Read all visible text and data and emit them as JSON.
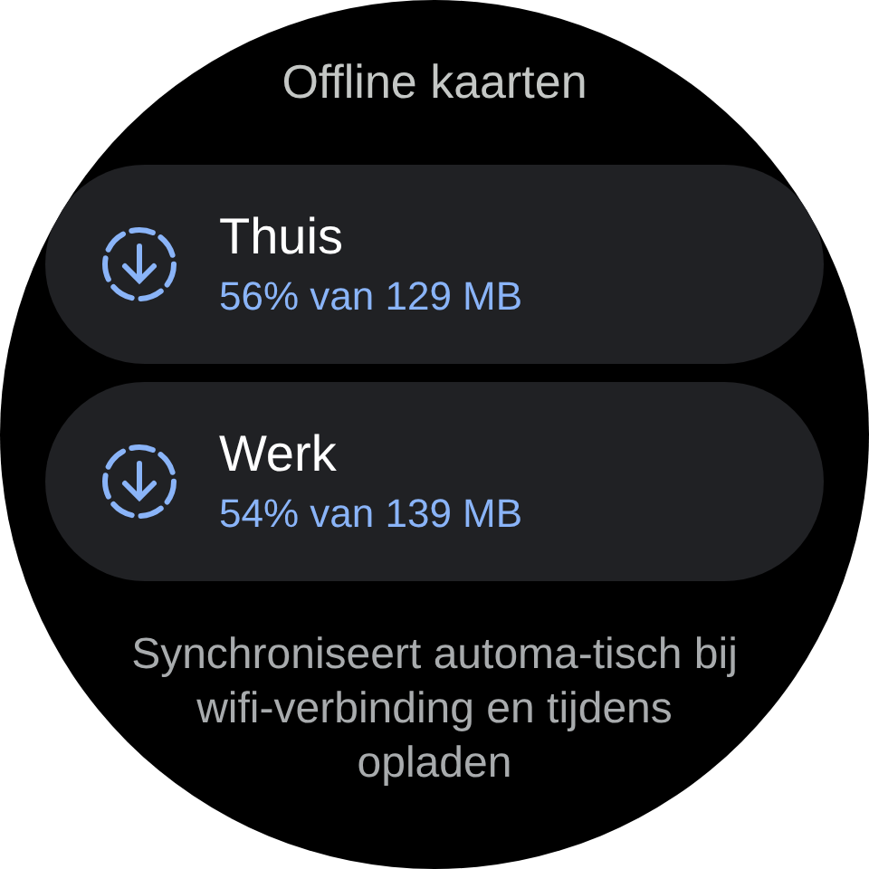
{
  "title": "Offline kaarten",
  "maps": [
    {
      "name": "Thuis",
      "progress": "56% van 129 MB"
    },
    {
      "name": "Werk",
      "progress": "54% van 139 MB"
    }
  ],
  "footer": "Synchroniseert automa-tisch bij wifi-verbinding en tijdens opladen"
}
